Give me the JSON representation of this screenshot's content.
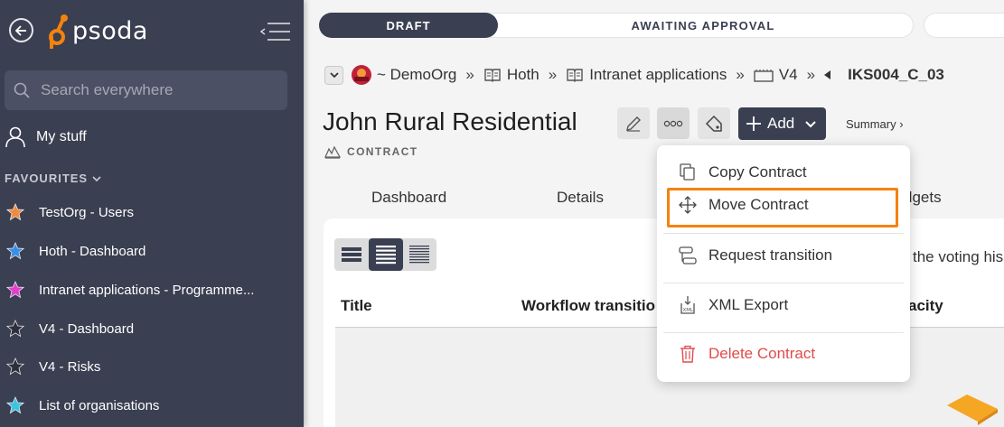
{
  "sidebar": {
    "logo_text": "psoda",
    "search_placeholder": "Search everywhere",
    "my_stuff": "My stuff",
    "favourites_heading": "FAVOURITES",
    "favourites": [
      {
        "label": "TestOrg - Users",
        "star_color": "#f28a3c"
      },
      {
        "label": "Hoth - Dashboard",
        "star_color": "#3a8ee6"
      },
      {
        "label": "Intranet applications - Programme...",
        "star_color": "#e040d0"
      },
      {
        "label": "V4 - Dashboard",
        "star_color": "#2c2f3a"
      },
      {
        "label": "V4 - Risks",
        "star_color": "#2c2f3a"
      },
      {
        "label": "List of organisations",
        "star_color": "#3cc4e0"
      }
    ]
  },
  "workflow": {
    "current": "DRAFT",
    "next": "AWAITING APPROVAL"
  },
  "breadcrumb": {
    "org": "~ DemoOrg",
    "items": [
      "Hoth",
      "Intranet applications",
      "V4"
    ],
    "current": "IKS004_C_03",
    "separator": "»"
  },
  "header": {
    "title": "John Rural Residential",
    "type": "CONTRACT",
    "add_label": "Add",
    "summary_link": "Summary ›"
  },
  "tabs": [
    "Dashboard",
    "Details",
    "dgets"
  ],
  "table": {
    "partial_text": "the voting his",
    "columns": [
      "Title",
      "Workflow transitio",
      "acity"
    ]
  },
  "menu": {
    "items": [
      {
        "label": "Copy Contract",
        "icon": "copy-icon"
      },
      {
        "label": "Move Contract",
        "icon": "move-icon"
      },
      {
        "label": "Request transition",
        "icon": "transition-icon"
      },
      {
        "label": "XML Export",
        "icon": "xml-export-icon"
      },
      {
        "label": "Delete Contract",
        "icon": "trash-icon"
      }
    ]
  },
  "colors": {
    "sidebar_bg": "#3a3f51",
    "accent_dark": "#3a3f51",
    "brand_orange": "#f5820d",
    "danger": "#e04b4b"
  }
}
